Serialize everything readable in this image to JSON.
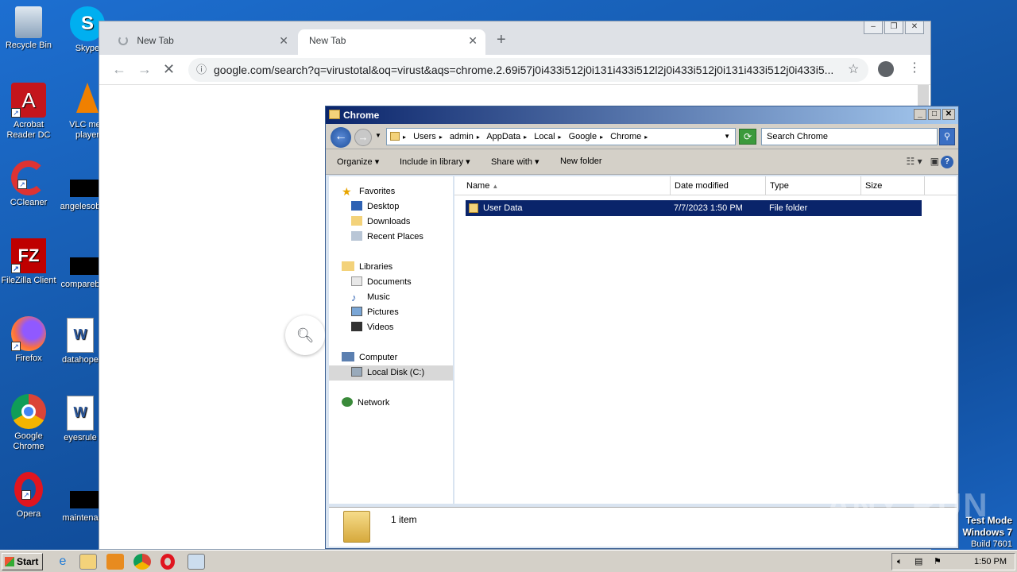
{
  "desktop": {
    "icons": [
      {
        "label": "Recycle Bin",
        "label2": "",
        "icon": "recycle-bin-icon"
      },
      {
        "label": "Skype",
        "label2": "",
        "icon": "skype-icon"
      },
      {
        "label": "Acrobat",
        "label2": "Reader DC",
        "icon": "acrobat-icon"
      },
      {
        "label": "VLC med",
        "label2": "player",
        "icon": "vlc-icon"
      },
      {
        "label": "CCleaner",
        "label2": "",
        "icon": "ccleaner-icon"
      },
      {
        "label": "angelesob",
        "label2": "",
        "icon": "blank-file-icon"
      },
      {
        "label": "FileZilla Client",
        "label2": "",
        "icon": "filezilla-icon"
      },
      {
        "label": "compareb",
        "label2": "",
        "icon": "blank-file-icon"
      },
      {
        "label": "Firefox",
        "label2": "",
        "icon": "firefox-icon"
      },
      {
        "label": "datahope",
        "label2": "",
        "icon": "word-doc-icon"
      },
      {
        "label": "Google",
        "label2": "Chrome",
        "icon": "chrome-icon"
      },
      {
        "label": "eyesrule",
        "label2": "",
        "icon": "word-doc-icon"
      },
      {
        "label": "Opera",
        "label2": "",
        "icon": "opera-icon"
      },
      {
        "label": "maintena",
        "label2": "",
        "icon": "blank-file-icon"
      }
    ]
  },
  "chrome": {
    "tabs": [
      {
        "title": "New Tab",
        "loading": true
      },
      {
        "title": "New Tab",
        "active": true
      }
    ],
    "url": "google.com/search?q=virustotal&oq=virust&aqs=chrome.2.69i57j0i433i512j0i131i433i512l2j0i433i512j0i131i433i512j0i433i5..."
  },
  "explorer": {
    "title": "Chrome",
    "breadcrumb": [
      "Users",
      "admin",
      "AppData",
      "Local",
      "Google",
      "Chrome"
    ],
    "search_placeholder": "Search Chrome",
    "commands": {
      "organize": "Organize",
      "include": "Include in library",
      "share": "Share with",
      "new_folder": "New folder"
    },
    "nav": {
      "favorites": "Favorites",
      "desktop": "Desktop",
      "downloads": "Downloads",
      "recent": "Recent Places",
      "libraries": "Libraries",
      "documents": "Documents",
      "music": "Music",
      "pictures": "Pictures",
      "videos": "Videos",
      "computer": "Computer",
      "localdisk": "Local Disk (C:)",
      "network": "Network"
    },
    "columns": {
      "name": "Name",
      "date": "Date modified",
      "type": "Type",
      "size": "Size"
    },
    "rows": [
      {
        "name": "User Data",
        "date": "7/7/2023 1:50 PM",
        "type": "File folder",
        "size": ""
      }
    ],
    "status": "1 item"
  },
  "taskbar": {
    "start": "Start",
    "clock": "1:50 PM"
  },
  "os": {
    "line1": "Test Mode",
    "line2": "Windows 7",
    "line3": "Build 7601"
  },
  "watermark": "ANY RUN"
}
